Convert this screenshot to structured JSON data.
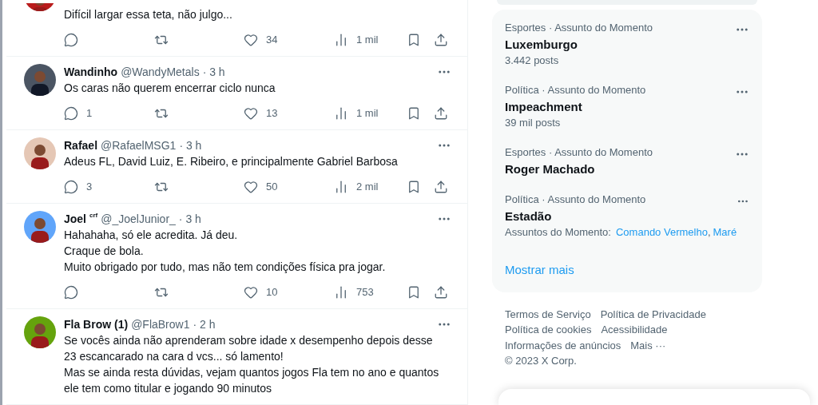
{
  "feed": {
    "tweets": [
      {
        "text": [
          "Difícil largar essa teta, não julgo..."
        ],
        "stats": {
          "likes": "34",
          "views": "1 mil"
        }
      },
      {
        "name": "Wandinho",
        "handle": "@WandyMetals",
        "time": "· 3 h",
        "text": [
          "Os caras não querem encerrar ciclo nunca"
        ],
        "stats": {
          "replies": "1",
          "likes": "13",
          "views": "1 mil"
        }
      },
      {
        "name": "Rafael",
        "handle": "@RafaelMSG1",
        "time": "· 3 h",
        "text": [
          "Adeus FL, David Luiz, E. Ribeiro, e principalmente Gabriel Barbosa"
        ],
        "stats": {
          "replies": "3",
          "likes": "50",
          "views": "2 mil"
        }
      },
      {
        "name": "Joel",
        "badge": "crf",
        "handle": "@_JoelJunior_",
        "time": "· 3 h",
        "text": [
          "Hahahaha, só ele acredita. Já deu.",
          "Craque de bola.",
          "Muito obrigado por tudo, mas não tem condições física pra jogar."
        ],
        "stats": {
          "likes": "10",
          "views": "753"
        }
      },
      {
        "name": "Fla Brow (1)",
        "handle": "@FlaBrow1",
        "time": "· 2 h",
        "text": [
          "Se vocês ainda não aprenderam sobre idade x desempenho depois desse",
          "23 escancarado na cara d vcs... só lamento!",
          "Mas se ainda resta dúvidas, vejam quantos jogos Fla tem no ano e quantos",
          "ele tem como titular e jogando 90 minutos"
        ]
      }
    ]
  },
  "trends": {
    "items": [
      {
        "category": "Esportes · Assunto do Momento",
        "title": "Luxemburgo",
        "posts": "3.442 posts"
      },
      {
        "category": "Política · Assunto do Momento",
        "title": "Impeachment",
        "posts": "39 mil posts"
      },
      {
        "category": "Esportes · Assunto do Momento",
        "title": "Roger Machado"
      },
      {
        "category": "Política · Assunto do Momento",
        "title": "Estadão",
        "related_label": "Assuntos do Momento:",
        "related": [
          "Comando Vermelho",
          "Maré"
        ],
        "related_separator": ","
      }
    ],
    "show_more": "Mostrar mais"
  },
  "footer": {
    "links": [
      "Termos de Serviço",
      "Política de Privacidade",
      "Política de cookies",
      "Acessibilidade",
      "Informações de anúncios",
      "Mais ···"
    ],
    "copyright": "© 2023 X Corp."
  }
}
